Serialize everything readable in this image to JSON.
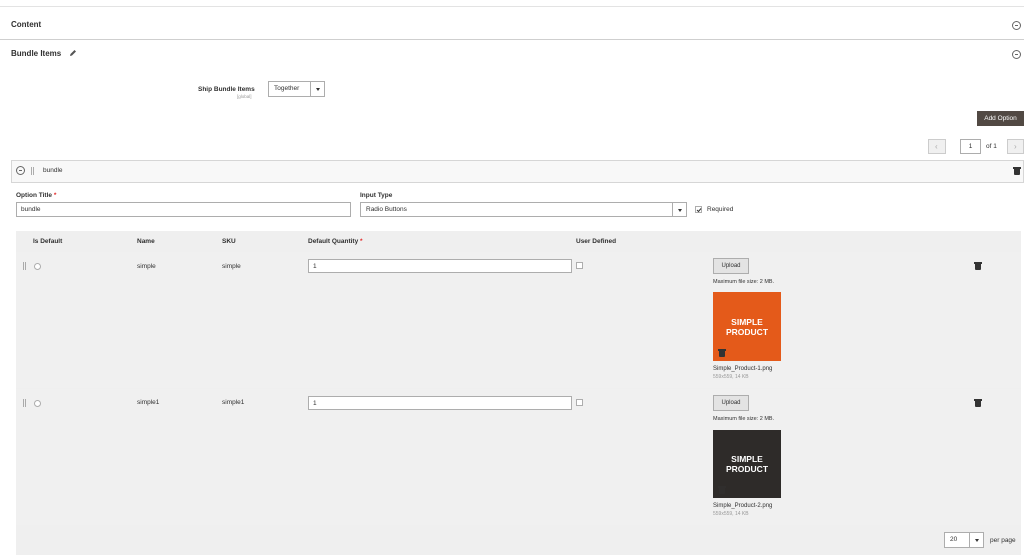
{
  "sections": {
    "content_title": "Content",
    "bundle_items_title": "Bundle Items"
  },
  "ship": {
    "label": "Ship Bundle Items",
    "scope": "[global]",
    "value": "Together"
  },
  "add_option_label": "Add Option",
  "pager": {
    "page": "1",
    "of_label": "of 1"
  },
  "option": {
    "header_title": "bundle",
    "title_label": "Option Title",
    "title_value": "bundle",
    "input_type_label": "Input Type",
    "input_type_value": "Radio Buttons",
    "required_label": "Required",
    "required_mark": "*"
  },
  "grid": {
    "headers": {
      "is_default": "Is Default",
      "name": "Name",
      "sku": "SKU",
      "default_quantity": "Default Quantity",
      "user_defined": "User Defined"
    },
    "rows": [
      {
        "name": "simple",
        "sku": "simple",
        "qty": "1",
        "upload_label": "Upload",
        "max_size": "Maximum file size: 2 MB.",
        "image_text_1": "SIMPLE",
        "image_text_2": "PRODUCT",
        "image_color": "#e45a1a",
        "file_name": "Simple_Product-1.png",
        "file_meta": "559x559, 14 KB"
      },
      {
        "name": "simple1",
        "sku": "simple1",
        "qty": "1",
        "upload_label": "Upload",
        "max_size": "Maximum file size: 2 MB.",
        "image_text_1": "SIMPLE",
        "image_text_2": "PRODUCT",
        "image_color": "#2e2b29",
        "file_name": "Simple_Product-2.png",
        "file_meta": "559x559, 14 KB"
      }
    ]
  },
  "footer": {
    "per_page_value": "20",
    "per_page_label": "per page"
  }
}
